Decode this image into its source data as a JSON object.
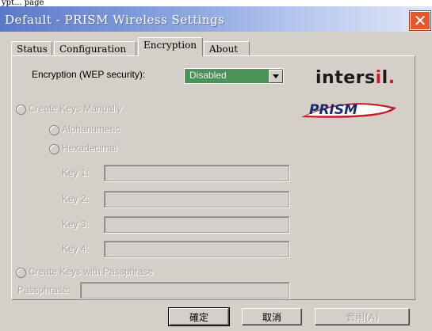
{
  "top_caption": "ypt... page",
  "window": {
    "title": "Default - PRISM Wireless Settings",
    "close_glyph": "✕"
  },
  "tabs": [
    {
      "label": "Status",
      "active": false
    },
    {
      "label": "Configuration",
      "active": false
    },
    {
      "label": "Encryption",
      "active": true
    },
    {
      "label": "About",
      "active": false
    }
  ],
  "encryption": {
    "label": "Encryption (WEP security):",
    "selected": "Disabled"
  },
  "manual": {
    "radio_label": "Create Keys Manually",
    "alphanumeric_label": "Alphanumeric",
    "hexadecimal_label": "Hexadecimal",
    "keys": [
      {
        "label": "Key 1:",
        "value": ""
      },
      {
        "label": "Key 2:",
        "value": ""
      },
      {
        "label": "Key 3:",
        "value": ""
      },
      {
        "label": "Key 4:",
        "value": ""
      }
    ]
  },
  "passphrase": {
    "radio_label": "Create Keys with Passphrase",
    "label": "Passphrase:",
    "value": ""
  },
  "logos": {
    "intersil_main": "inters",
    "intersil_i": "i",
    "intersil_l": "l",
    "intersil_dot": ".",
    "prism": "PRISM"
  },
  "buttons": {
    "ok": "確定",
    "cancel": "取消",
    "apply": "套用(A)"
  },
  "colors": {
    "dialog_bg": "#d4d0c8",
    "title_gradient_start": "#5a79c9",
    "close_red": "#e3582a",
    "select_bg": "#4a9258",
    "prism_red": "#c0202a",
    "prism_navy": "#1d2a6b"
  }
}
